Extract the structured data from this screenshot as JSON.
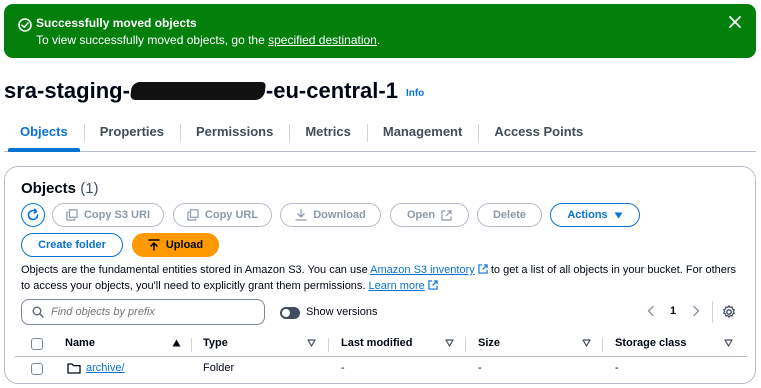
{
  "flash": {
    "title": "Successfully moved objects",
    "message_prefix": "To view successfully moved objects, go the ",
    "link": "specified destination",
    "message_suffix": ".",
    "color": "#037f0c",
    "icon": "check-circle-icon",
    "close_icon": "close-icon"
  },
  "bucket": {
    "name_prefix": "sra-staging-",
    "name_suffix": "-eu-central-1",
    "info": "Info"
  },
  "tabs": [
    {
      "label": "Objects",
      "active": true
    },
    {
      "label": "Properties"
    },
    {
      "label": "Permissions"
    },
    {
      "label": "Metrics"
    },
    {
      "label": "Management"
    },
    {
      "label": "Access Points"
    }
  ],
  "objects_panel": {
    "heading": "Objects",
    "count": "(1)",
    "buttons": {
      "refresh": "refresh-icon",
      "copy_s3_uri": "Copy S3 URI",
      "copy_url": "Copy URL",
      "download": "Download",
      "open": "Open",
      "delete": "Delete",
      "actions": "Actions",
      "create_folder": "Create folder",
      "upload": "Upload"
    },
    "description": {
      "part1": "Objects are the fundamental entities stored in Amazon S3. You can use ",
      "link1": "Amazon S3 inventory",
      "part2": " to get a list of all objects in your bucket. For others to access your objects, you'll need to explicitly grant them permissions. ",
      "link2": "Learn more"
    },
    "search": {
      "placeholder": "Find objects by prefix"
    },
    "show_versions": "Show versions",
    "page": "1",
    "columns": [
      "Name",
      "Type",
      "Last modified",
      "Size",
      "Storage class"
    ],
    "rows": [
      {
        "name": "archive/",
        "type": "Folder",
        "last_modified": "-",
        "size": "-",
        "storage_class": "-"
      }
    ],
    "colors": {
      "accent": "#0972d3",
      "upload": "#ff9900"
    }
  }
}
